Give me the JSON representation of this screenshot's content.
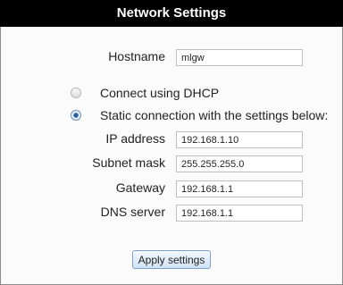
{
  "header": {
    "title": "Network Settings"
  },
  "hostname": {
    "label": "Hostname",
    "value": "mlgw"
  },
  "connection": {
    "dhcp_label": "Connect using DHCP",
    "static_label": "Static connection with the settings below:",
    "selected": "static"
  },
  "fields": {
    "ip": {
      "label": "IP address",
      "value": "192.168.1.10"
    },
    "subnet": {
      "label": "Subnet mask",
      "value": "255.255.255.0"
    },
    "gateway": {
      "label": "Gateway",
      "value": "192.168.1.1"
    },
    "dns": {
      "label": "DNS server",
      "value": "192.168.1.1"
    }
  },
  "actions": {
    "apply_label": "Apply settings"
  }
}
